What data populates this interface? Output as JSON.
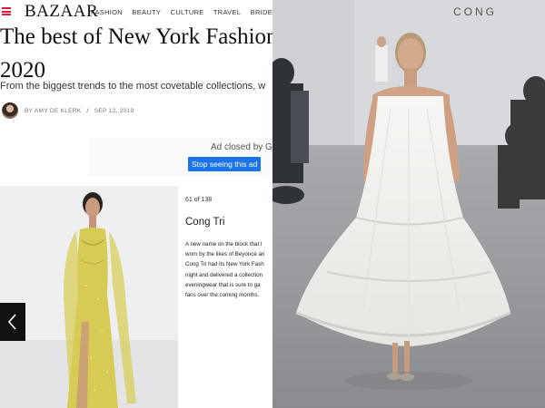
{
  "nav": {
    "brand": "BAZAAR",
    "links": [
      "FASHION",
      "BEAUTY",
      "CULTURE",
      "TRAVEL",
      "BRIDES"
    ]
  },
  "article": {
    "headline_line1": "The best of New York Fashion",
    "headline_line2": "2020",
    "subhead": "From the biggest trends to the most covetable collections, w",
    "author": "BY AMY DE KLERK",
    "separator": "/",
    "date": "SEP 12, 2019"
  },
  "ad": {
    "closed_text": "Ad closed by G",
    "stop_label": "Stop seeing this ad"
  },
  "gallery": {
    "counter": "61 of 138",
    "title": "Cong Tri",
    "body_lines": [
      "A new name on the block that l",
      "worn by the likes of Beyoncé an",
      "Cong Tri had its New York Fash",
      "night and delivered a collection",
      "eveningwear that is sure to ga",
      "fans over the coming months."
    ]
  },
  "runway": {
    "wall_text": "CONG"
  },
  "colors": {
    "accent": "#e0193a",
    "ad_button": "#1a73e8"
  }
}
